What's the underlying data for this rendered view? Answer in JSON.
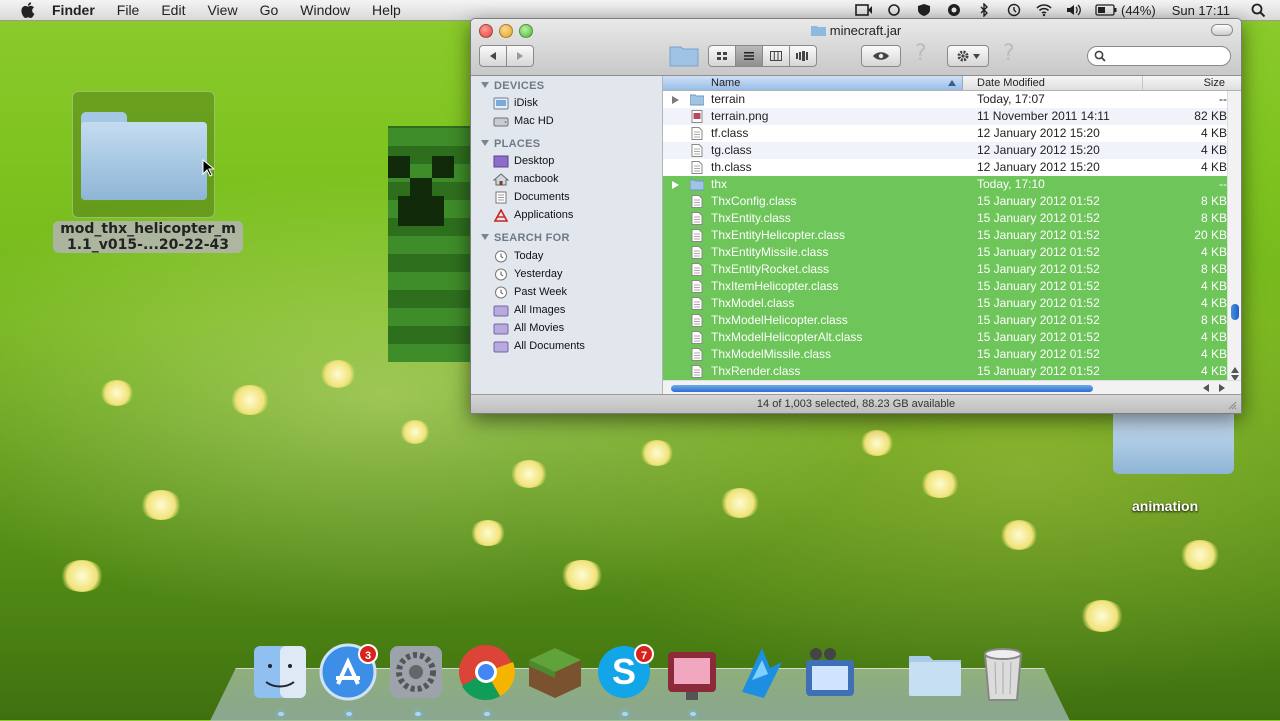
{
  "menubar": {
    "app": "Finder",
    "items": [
      "File",
      "Edit",
      "View",
      "Go",
      "Window",
      "Help"
    ],
    "battery": "(44%)",
    "clock": "Sun 17:11"
  },
  "desktop": {
    "selected_folder_label_line1": "mod_thx_helicopter_m",
    "selected_folder_label_line2": "1.1_v015-...20-22-43",
    "right_folder_label": "animation"
  },
  "finder": {
    "title": "minecraft.jar",
    "search_placeholder": "",
    "sidebar": {
      "sections": [
        {
          "heading": "DEVICES",
          "items": [
            "iDisk",
            "Mac HD"
          ]
        },
        {
          "heading": "PLACES",
          "items": [
            "Desktop",
            "macbook",
            "Documents",
            "Applications"
          ]
        },
        {
          "heading": "SEARCH FOR",
          "items": [
            "Today",
            "Yesterday",
            "Past Week",
            "All Images",
            "All Movies",
            "All Documents"
          ]
        }
      ]
    },
    "columns": {
      "name": "Name",
      "date": "Date Modified",
      "size": "Size"
    },
    "rows": [
      {
        "name": "terrain",
        "date": "Today, 17:07",
        "size": "--",
        "kind": "folder",
        "selected": false
      },
      {
        "name": "terrain.png",
        "date": "11 November 2011 14:11",
        "size": "82 KB",
        "kind": "image",
        "selected": false
      },
      {
        "name": "tf.class",
        "date": "12 January 2012 15:20",
        "size": "4 KB",
        "kind": "file",
        "selected": false
      },
      {
        "name": "tg.class",
        "date": "12 January 2012 15:20",
        "size": "4 KB",
        "kind": "file",
        "selected": false
      },
      {
        "name": "th.class",
        "date": "12 January 2012 15:20",
        "size": "4 KB",
        "kind": "file",
        "selected": false
      },
      {
        "name": "thx",
        "date": "Today, 17:10",
        "size": "--",
        "kind": "folder",
        "selected": true
      },
      {
        "name": "ThxConfig.class",
        "date": "15 January 2012 01:52",
        "size": "8 KB",
        "kind": "file",
        "selected": true
      },
      {
        "name": "ThxEntity.class",
        "date": "15 January 2012 01:52",
        "size": "8 KB",
        "kind": "file",
        "selected": true
      },
      {
        "name": "ThxEntityHelicopter.class",
        "date": "15 January 2012 01:52",
        "size": "20 KB",
        "kind": "file",
        "selected": true
      },
      {
        "name": "ThxEntityMissile.class",
        "date": "15 January 2012 01:52",
        "size": "4 KB",
        "kind": "file",
        "selected": true
      },
      {
        "name": "ThxEntityRocket.class",
        "date": "15 January 2012 01:52",
        "size": "8 KB",
        "kind": "file",
        "selected": true
      },
      {
        "name": "ThxItemHelicopter.class",
        "date": "15 January 2012 01:52",
        "size": "4 KB",
        "kind": "file",
        "selected": true
      },
      {
        "name": "ThxModel.class",
        "date": "15 January 2012 01:52",
        "size": "4 KB",
        "kind": "file",
        "selected": true
      },
      {
        "name": "ThxModelHelicopter.class",
        "date": "15 January 2012 01:52",
        "size": "8 KB",
        "kind": "file",
        "selected": true
      },
      {
        "name": "ThxModelHelicopterAlt.class",
        "date": "15 January 2012 01:52",
        "size": "4 KB",
        "kind": "file",
        "selected": true
      },
      {
        "name": "ThxModelMissile.class",
        "date": "15 January 2012 01:52",
        "size": "4 KB",
        "kind": "file",
        "selected": true
      },
      {
        "name": "ThxRender.class",
        "date": "15 January 2012 01:52",
        "size": "4 KB",
        "kind": "file",
        "selected": true
      }
    ],
    "status": "14 of 1,003 selected, 88.23 GB available"
  },
  "dock": {
    "items": [
      {
        "name": "finder",
        "badge": null
      },
      {
        "name": "app-store",
        "badge": "3"
      },
      {
        "name": "system-preferences",
        "badge": null
      },
      {
        "name": "chrome",
        "badge": null
      },
      {
        "name": "minecraft",
        "badge": null
      },
      {
        "name": "skype",
        "badge": "7"
      },
      {
        "name": "photo-booth",
        "badge": null
      },
      {
        "name": "app-7",
        "badge": null
      },
      {
        "name": "app-8",
        "badge": null
      },
      {
        "name": "folder-stack",
        "badge": null
      },
      {
        "name": "trash",
        "badge": null
      }
    ]
  }
}
